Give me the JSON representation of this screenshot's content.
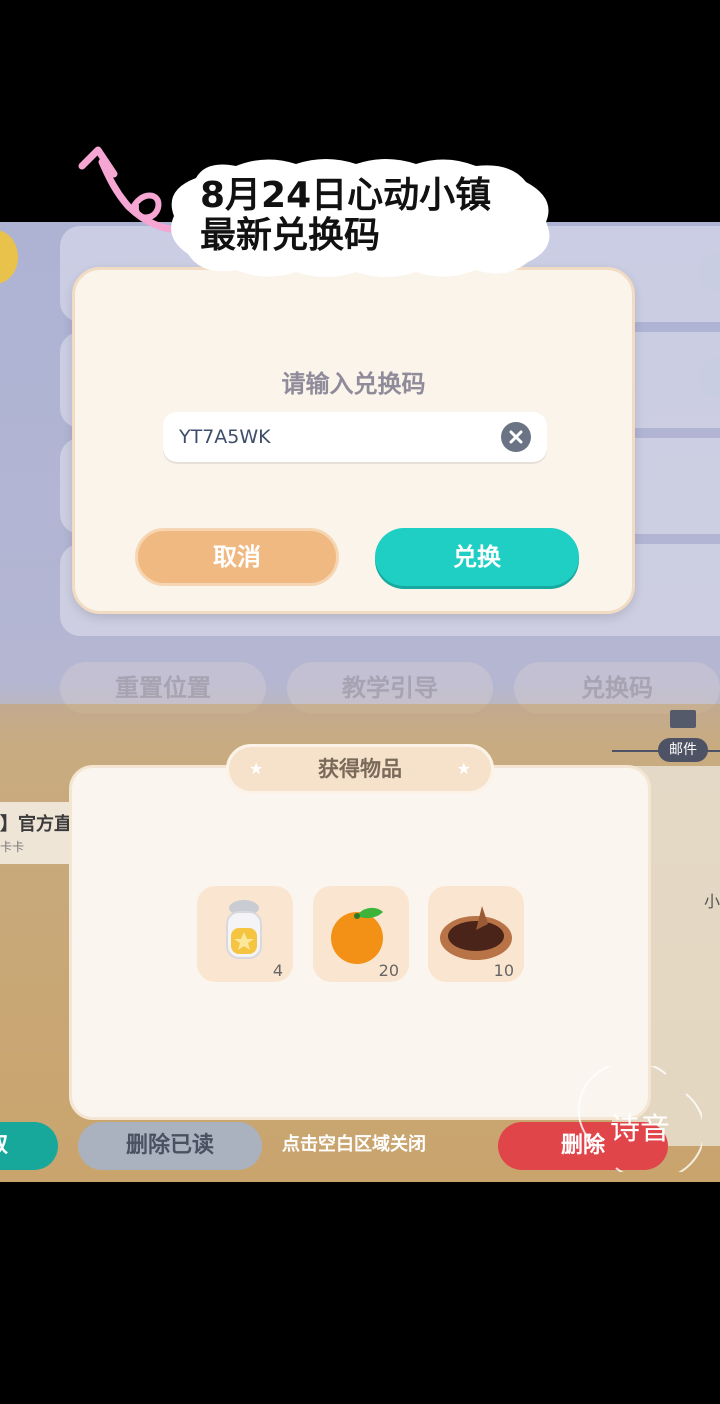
{
  "caption": {
    "line1": "8月24日心动小镇",
    "line2": "最新兑换码"
  },
  "redeem_dialog": {
    "title": "请输入兑换码",
    "code_value": "YT7A5WK",
    "cancel_label": "取消",
    "redeem_label": "兑换"
  },
  "background": {
    "tabs": [
      "重置位置",
      "教学引导",
      "兑换码"
    ],
    "mail_label": "邮件",
    "mail_item_title": "】官方直",
    "mail_item_sub": "卡卡",
    "right_text": "小",
    "claim_label": "取",
    "delete_read_label": "删除已读",
    "delete_label": "删除"
  },
  "reward_dialog": {
    "title": "获得物品",
    "items": [
      {
        "name": "salt-shaker-icon",
        "count": "4"
      },
      {
        "name": "orange-icon",
        "count": "20"
      },
      {
        "name": "pie-icon",
        "count": "10"
      }
    ],
    "close_hint": "点击空白区域关闭"
  },
  "watermark": "诗音",
  "colors": {
    "redeem_button": "#1fcfc3",
    "cancel_button": "#f0b982",
    "dialog_bg": "#faf4ea"
  }
}
